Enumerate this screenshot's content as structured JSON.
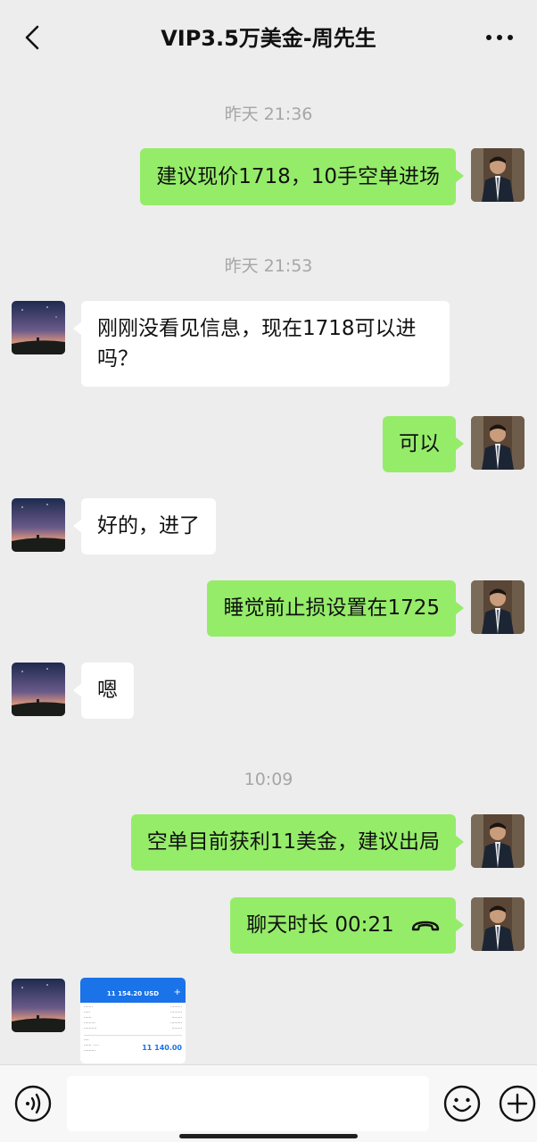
{
  "header": {
    "title": "VIP3.5万美金-周先生",
    "back_icon": "chevron-left-icon",
    "more_icon": "more-dots-icon"
  },
  "messages": {
    "ts1": "昨天 21:36",
    "m1": "建议现价1718，10手空单进场",
    "ts2": "昨天 21:53",
    "m2_line1": "刚刚没看见信息，现在1718可以进",
    "m2_line2": "吗？",
    "m3": "可以",
    "m4": "好的，进了",
    "m5": "睡觉前止损设置在1725",
    "m6": "嗯",
    "ts3": "10:09",
    "m7": "空单目前获利11美金，建议出局",
    "m8_label": "聊天时长 00:21",
    "m8_icon": "hang-up-icon"
  },
  "screenshot_thumb": {
    "balance": "11 154.20 USD",
    "total": "11 140.00"
  },
  "input_bar": {
    "voice_icon": "voice-icon",
    "emoji_icon": "emoji-icon",
    "plus_icon": "plus-icon"
  },
  "colors": {
    "background": "#ededed",
    "outgoing_bubble": "#95ec69",
    "incoming_bubble": "#ffffff",
    "timestamp_text": "#a6a6a6"
  }
}
